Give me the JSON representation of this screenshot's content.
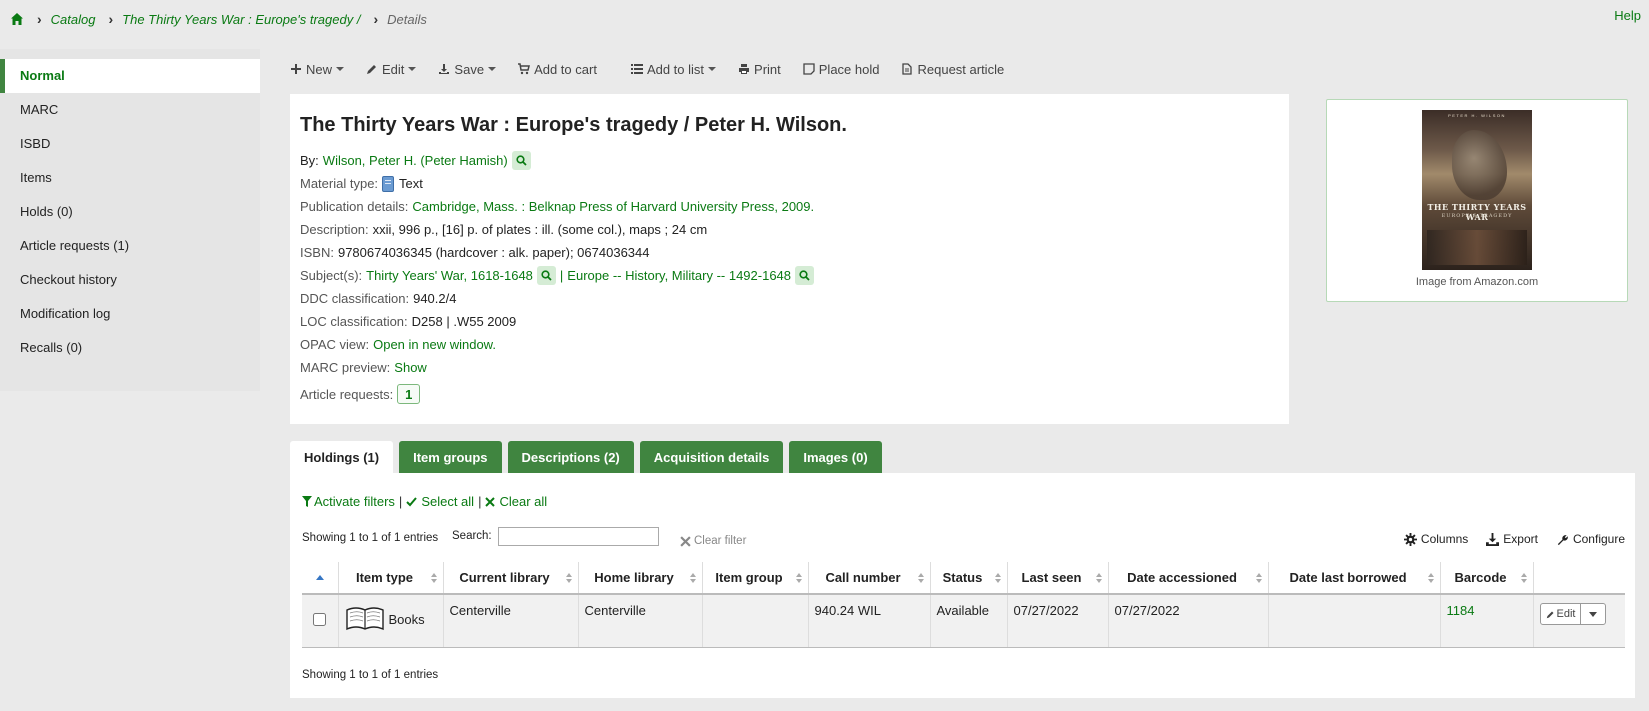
{
  "breadcrumb": {
    "catalog": "Catalog",
    "record": "The Thirty Years War : Europe's tragedy /",
    "current": "Details"
  },
  "help": "Help",
  "sidebar": {
    "items": [
      {
        "label": "Normal",
        "active": true
      },
      {
        "label": "MARC"
      },
      {
        "label": "ISBD"
      },
      {
        "label": "Items"
      },
      {
        "label": "Holds (0)"
      },
      {
        "label": "Article requests (1)"
      },
      {
        "label": "Checkout history"
      },
      {
        "label": "Modification log"
      },
      {
        "label": "Recalls (0)"
      }
    ]
  },
  "toolbar": {
    "new": "New",
    "edit": "Edit",
    "save": "Save",
    "add_to_cart": "Add to cart",
    "add_to_list": "Add to list",
    "print": "Print",
    "place_hold": "Place hold",
    "request_article": "Request article"
  },
  "record": {
    "title": "The Thirty Years War : Europe's tragedy / Peter H. Wilson.",
    "by_label": "By:",
    "author": "Wilson, Peter H. (Peter Hamish)",
    "material_label": "Material type:",
    "material": "Text",
    "pub_label": "Publication details:",
    "pub": "Cambridge, Mass. : Belknap Press of Harvard University Press, 2009.",
    "desc_label": "Description:",
    "desc": "xxii, 996 p., [16] p. of plates : ill. (some col.), maps ; 24 cm",
    "isbn_label": "ISBN:",
    "isbn": "9780674036345 (hardcover : alk. paper); 0674036344",
    "subj_label": "Subject(s):",
    "subj1": "Thirty Years' War, 1618-1648",
    "subj_sep": "|",
    "subj2": "Europe -- History, Military -- 1492-1648",
    "ddc_label": "DDC classification:",
    "ddc": "940.2/4",
    "loc_label": "LOC classification:",
    "loc": "D258 | .W55 2009",
    "opac_label": "OPAC view:",
    "opac": "Open in new window.",
    "marc_label": "MARC preview:",
    "marc": "Show",
    "article_label": "Article requests:",
    "article_count": "1"
  },
  "cover": {
    "author": "PETER H. WILSON",
    "title": "THE THIRTY YEARS WAR",
    "subtitle": "EUROPE'S TRAGEDY",
    "caption": "Image from Amazon.com"
  },
  "tabs": [
    {
      "label": "Holdings (1)",
      "active": true
    },
    {
      "label": "Item groups"
    },
    {
      "label": "Descriptions (2)"
    },
    {
      "label": "Acquisition details"
    },
    {
      "label": "Images (0)"
    }
  ],
  "holdings": {
    "activate_filters": "Activate filters",
    "pipe": "|",
    "select_all": "Select all",
    "clear_all": "Clear all",
    "showing": "Showing 1 to 1 of 1 entries",
    "search_label": "Search:",
    "search_value": "",
    "clear_filter": "Clear filter",
    "columns": "Columns",
    "export": "Export",
    "configure": "Configure",
    "headers": [
      "Item type",
      "Current library",
      "Home library",
      "Item group",
      "Call number",
      "Status",
      "Last seen",
      "Date accessioned",
      "Date last borrowed",
      "Barcode"
    ],
    "row": {
      "item_type": "Books",
      "current_library": "Centerville",
      "home_library": "Centerville",
      "item_group": "",
      "call_number": "940.24 WIL",
      "status": "Available",
      "last_seen": "07/27/2022",
      "date_accessioned": "07/27/2022",
      "date_last_borrowed": "",
      "barcode": "1184",
      "edit": "Edit"
    },
    "showing_bottom": "Showing 1 to 1 of 1 entries"
  }
}
